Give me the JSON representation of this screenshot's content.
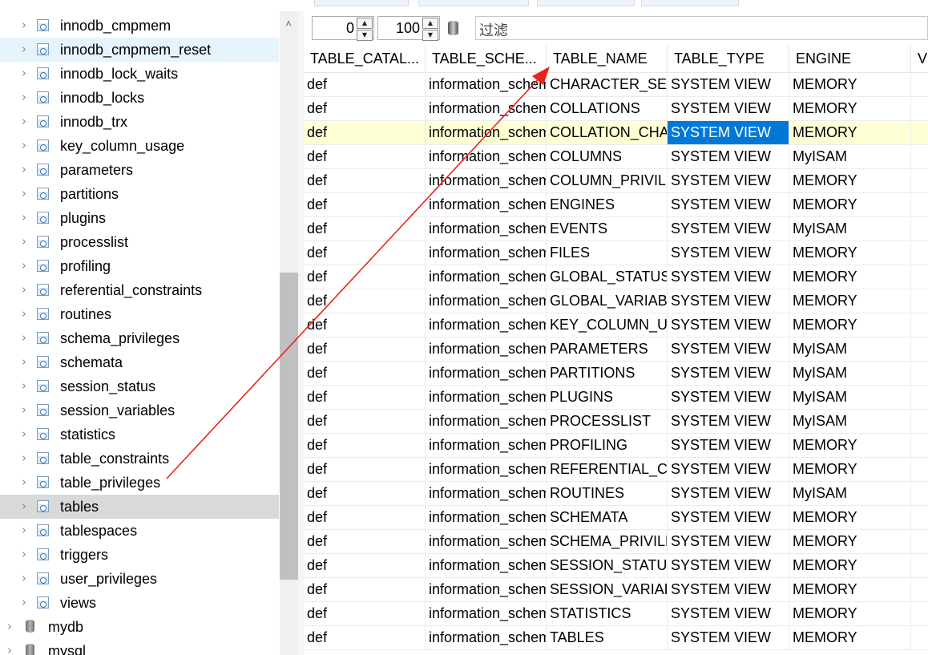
{
  "sidebar": {
    "items": [
      {
        "label": "innodb_cmpmem",
        "kind": "table",
        "level": 2,
        "state": ""
      },
      {
        "label": "innodb_cmpmem_reset",
        "kind": "table",
        "level": 2,
        "state": "hover"
      },
      {
        "label": "innodb_lock_waits",
        "kind": "table",
        "level": 2,
        "state": ""
      },
      {
        "label": "innodb_locks",
        "kind": "table",
        "level": 2,
        "state": ""
      },
      {
        "label": "innodb_trx",
        "kind": "table",
        "level": 2,
        "state": ""
      },
      {
        "label": "key_column_usage",
        "kind": "table",
        "level": 2,
        "state": ""
      },
      {
        "label": "parameters",
        "kind": "table",
        "level": 2,
        "state": ""
      },
      {
        "label": "partitions",
        "kind": "table",
        "level": 2,
        "state": ""
      },
      {
        "label": "plugins",
        "kind": "table",
        "level": 2,
        "state": ""
      },
      {
        "label": "processlist",
        "kind": "table",
        "level": 2,
        "state": ""
      },
      {
        "label": "profiling",
        "kind": "table",
        "level": 2,
        "state": ""
      },
      {
        "label": "referential_constraints",
        "kind": "table",
        "level": 2,
        "state": ""
      },
      {
        "label": "routines",
        "kind": "table",
        "level": 2,
        "state": ""
      },
      {
        "label": "schema_privileges",
        "kind": "table",
        "level": 2,
        "state": ""
      },
      {
        "label": "schemata",
        "kind": "table",
        "level": 2,
        "state": ""
      },
      {
        "label": "session_status",
        "kind": "table",
        "level": 2,
        "state": ""
      },
      {
        "label": "session_variables",
        "kind": "table",
        "level": 2,
        "state": ""
      },
      {
        "label": "statistics",
        "kind": "table",
        "level": 2,
        "state": ""
      },
      {
        "label": "table_constraints",
        "kind": "table",
        "level": 2,
        "state": ""
      },
      {
        "label": "table_privileges",
        "kind": "table",
        "level": 2,
        "state": ""
      },
      {
        "label": "tables",
        "kind": "table",
        "level": 2,
        "state": "selected"
      },
      {
        "label": "tablespaces",
        "kind": "table",
        "level": 2,
        "state": ""
      },
      {
        "label": "triggers",
        "kind": "table",
        "level": 2,
        "state": ""
      },
      {
        "label": "user_privileges",
        "kind": "table",
        "level": 2,
        "state": ""
      },
      {
        "label": "views",
        "kind": "table",
        "level": 2,
        "state": ""
      },
      {
        "label": "mydb",
        "kind": "database",
        "level": 1,
        "state": ""
      },
      {
        "label": "mysql",
        "kind": "database",
        "level": 1,
        "state": ""
      }
    ]
  },
  "toolbar": {
    "offset_value": "0",
    "limit_value": "100",
    "filter_placeholder": "过滤"
  },
  "grid": {
    "columns": [
      "TABLE_CATAL...",
      "TABLE_SCHE...",
      "TABLE_NAME",
      "TABLE_TYPE",
      "ENGINE",
      "VE"
    ],
    "selected_row": 2,
    "focus_col": 3,
    "rows": [
      [
        "def",
        "information_schema",
        "CHARACTER_SETS",
        "SYSTEM VIEW",
        "MEMORY"
      ],
      [
        "def",
        "information_schema",
        "COLLATIONS",
        "SYSTEM VIEW",
        "MEMORY"
      ],
      [
        "def",
        "information_schema",
        "COLLATION_CHARACTER_SET_APPLICABILITY",
        "SYSTEM VIEW",
        "MEMORY"
      ],
      [
        "def",
        "information_schema",
        "COLUMNS",
        "SYSTEM VIEW",
        "MyISAM"
      ],
      [
        "def",
        "information_schema",
        "COLUMN_PRIVILEGES",
        "SYSTEM VIEW",
        "MEMORY"
      ],
      [
        "def",
        "information_schema",
        "ENGINES",
        "SYSTEM VIEW",
        "MEMORY"
      ],
      [
        "def",
        "information_schema",
        "EVENTS",
        "SYSTEM VIEW",
        "MyISAM"
      ],
      [
        "def",
        "information_schema",
        "FILES",
        "SYSTEM VIEW",
        "MEMORY"
      ],
      [
        "def",
        "information_schema",
        "GLOBAL_STATUS",
        "SYSTEM VIEW",
        "MEMORY"
      ],
      [
        "def",
        "information_schema",
        "GLOBAL_VARIABLES",
        "SYSTEM VIEW",
        "MEMORY"
      ],
      [
        "def",
        "information_schema",
        "KEY_COLUMN_USAGE",
        "SYSTEM VIEW",
        "MEMORY"
      ],
      [
        "def",
        "information_schema",
        "PARAMETERS",
        "SYSTEM VIEW",
        "MyISAM"
      ],
      [
        "def",
        "information_schema",
        "PARTITIONS",
        "SYSTEM VIEW",
        "MyISAM"
      ],
      [
        "def",
        "information_schema",
        "PLUGINS",
        "SYSTEM VIEW",
        "MyISAM"
      ],
      [
        "def",
        "information_schema",
        "PROCESSLIST",
        "SYSTEM VIEW",
        "MyISAM"
      ],
      [
        "def",
        "information_schema",
        "PROFILING",
        "SYSTEM VIEW",
        "MEMORY"
      ],
      [
        "def",
        "information_schema",
        "REFERENTIAL_CONSTRAINTS",
        "SYSTEM VIEW",
        "MEMORY"
      ],
      [
        "def",
        "information_schema",
        "ROUTINES",
        "SYSTEM VIEW",
        "MyISAM"
      ],
      [
        "def",
        "information_schema",
        "SCHEMATA",
        "SYSTEM VIEW",
        "MEMORY"
      ],
      [
        "def",
        "information_schema",
        "SCHEMA_PRIVILEGES",
        "SYSTEM VIEW",
        "MEMORY"
      ],
      [
        "def",
        "information_schema",
        "SESSION_STATUS",
        "SYSTEM VIEW",
        "MEMORY"
      ],
      [
        "def",
        "information_schema",
        "SESSION_VARIABLES",
        "SYSTEM VIEW",
        "MEMORY"
      ],
      [
        "def",
        "information_schema",
        "STATISTICS",
        "SYSTEM VIEW",
        "MEMORY"
      ],
      [
        "def",
        "information_schema",
        "TABLES",
        "SYSTEM VIEW",
        "MEMORY"
      ]
    ]
  },
  "colors": {
    "selection": "#0078d7",
    "row_highlight": "#ffffd6",
    "tree_selected": "#d9d9d9",
    "tree_hover": "#e5f3fb",
    "annotation_arrow": "#e8231b"
  },
  "icons": {
    "tree_expander": "chevron-right-icon",
    "table_node": "table-icon",
    "database_node": "database-icon",
    "spinner": "spin-arrows-icon",
    "filter": "database-filter-icon",
    "annotation": "red-arrow-icon"
  }
}
